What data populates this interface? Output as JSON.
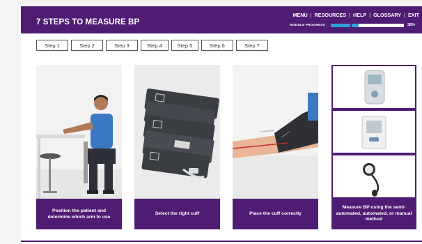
{
  "header": {
    "title": "7 STEPS TO MEASURE BP",
    "nav": [
      "MENU",
      "RESOURCES",
      "HELP",
      "GLOSSARY",
      "EXIT"
    ],
    "progress_label": "MODULE PROGRESS",
    "progress_percent_text": "38%",
    "progress_value": 0.38
  },
  "steps": [
    {
      "label": "Step 1"
    },
    {
      "label": "Step 2"
    },
    {
      "label": "Step 3"
    },
    {
      "label": "Step 4"
    },
    {
      "label": "Step 5"
    },
    {
      "label": "Step 6"
    },
    {
      "label": "Step 7"
    }
  ],
  "cards": [
    {
      "caption": "Position the patient and determine which arm to use"
    },
    {
      "caption": "Select the right cuff"
    },
    {
      "caption": "Place the cuff correctly"
    },
    {
      "caption": "Measure BP using the semi-automated, automated, or manual method"
    }
  ],
  "colors": {
    "brand_purple": "#4f1c73",
    "progress_blue": "#2f9fd8"
  }
}
